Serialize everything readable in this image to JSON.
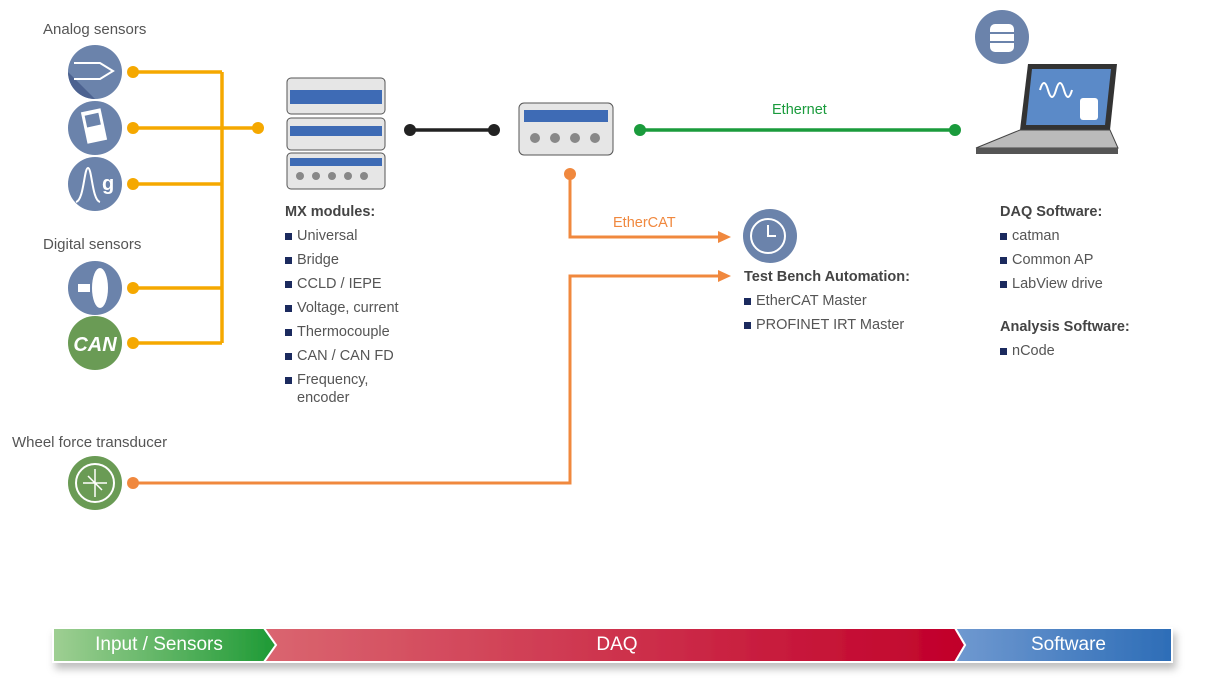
{
  "sensors": {
    "analog_label": "Analog sensors",
    "digital_label": "Digital sensors",
    "wheel_label": "Wheel force transducer",
    "can_icon_text": "CAN",
    "g_icon_text": "g"
  },
  "connections": {
    "ethernet_label": "Ethernet",
    "ethercat_label": "EtherCAT"
  },
  "mx_modules": {
    "title": "MX modules:",
    "items": [
      "Universal",
      "Bridge",
      "CCLD / IEPE",
      "Voltage, current",
      "Thermocouple",
      "CAN / CAN FD",
      "Frequency, encoder"
    ]
  },
  "test_bench": {
    "title": "Test Bench Automation:",
    "items": [
      "EtherCAT Master",
      "PROFINET IRT Master"
    ]
  },
  "daq_software": {
    "title": "DAQ Software:",
    "items": [
      "catman",
      "Common AP",
      "LabView drive"
    ]
  },
  "analysis_software": {
    "title": "Analysis Software:",
    "items": [
      "nCode"
    ]
  },
  "stages": {
    "input": "Input / Sensors",
    "daq": "DAQ",
    "software": "Software"
  },
  "colors": {
    "analog_line": "#f5a800",
    "ethernet_line": "#1a9b3c",
    "ethercat_line": "#f0883e",
    "device_link": "#222222",
    "icon_blue": "#6b83ab",
    "icon_green": "#6a9b55",
    "bullet": "#1b2a5e"
  }
}
